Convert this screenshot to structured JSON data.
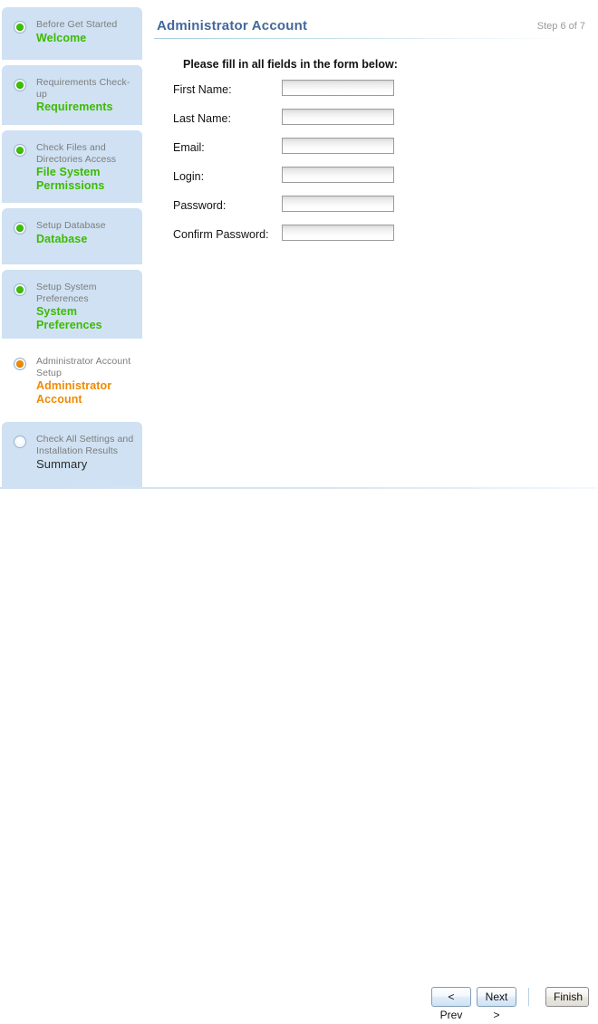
{
  "sidebar": {
    "steps": [
      {
        "sub": "Before Get Started",
        "title": "Welcome",
        "state": "done",
        "marker": "green-radio-filled-icon"
      },
      {
        "sub": "Requirements Check-up",
        "title": "Requirements",
        "state": "done",
        "marker": "green-radio-filled-icon"
      },
      {
        "sub": "Check Files and Directories Access",
        "title": "File System Permissions",
        "state": "done",
        "marker": "green-radio-filled-icon"
      },
      {
        "sub": "Setup Database",
        "title": "Database",
        "state": "done",
        "marker": "green-radio-filled-icon"
      },
      {
        "sub": "Setup System Preferences",
        "title": "System Preferences",
        "state": "done",
        "marker": "green-radio-filled-icon"
      },
      {
        "sub": "Administrator Account Setup",
        "title": "Administrator Account",
        "state": "active",
        "marker": "orange-radio-filled-icon"
      },
      {
        "sub": "Check All Settings and Installation Results",
        "title": "Summary",
        "state": "pending",
        "marker": "empty-radio-icon"
      }
    ]
  },
  "content": {
    "page_title": "Administrator Account",
    "step_counter": "Step 6 of 7",
    "form_heading": "Please fill in all fields in the form below:",
    "fields": [
      {
        "label": "First Name:",
        "value": "",
        "placeholder": "",
        "type": "text"
      },
      {
        "label": "Last Name:",
        "value": "",
        "placeholder": "",
        "type": "text"
      },
      {
        "label": "Email:",
        "value": "",
        "placeholder": "",
        "type": "text"
      },
      {
        "label": "Login:",
        "value": "",
        "placeholder": "",
        "type": "text"
      },
      {
        "label": "Password:",
        "value": "",
        "placeholder": "",
        "type": "password"
      },
      {
        "label": "Confirm Password:",
        "value": "",
        "placeholder": "",
        "type": "password"
      }
    ]
  },
  "footer": {
    "prev_label": "< Prev",
    "next_label": "Next >",
    "finish_label": "Finish"
  },
  "colors": {
    "sidebar_panel": "#cfe1f2",
    "active_panel": "#ffffff",
    "done_green": "#3cbb00",
    "active_orange": "#f08a00",
    "title_blue": "#44689b",
    "muted_gray": "#7c7c7c"
  }
}
